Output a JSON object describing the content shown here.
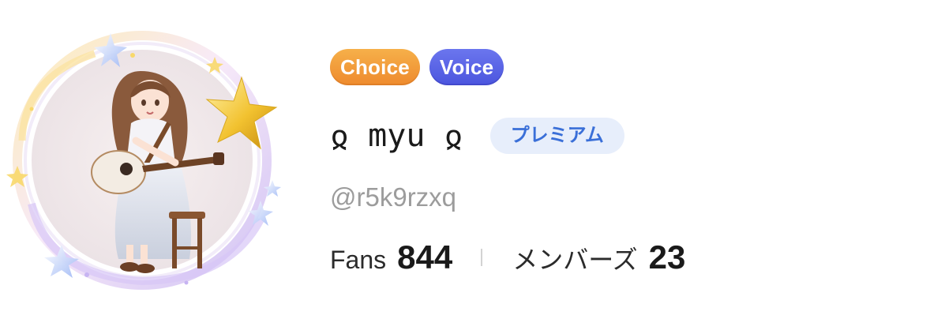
{
  "profile": {
    "badges": [
      {
        "label": "Choice",
        "color": "#ee8a2d"
      },
      {
        "label": "Voice",
        "color": "#4b55de"
      }
    ],
    "display_name": "ჲ myu ჲ",
    "premium_label": "プレミアム",
    "handle": "@r5k9rzxq",
    "stats": {
      "fans_label": "Fans",
      "fans_value": "844",
      "members_label": "メンバーズ",
      "members_value": "23"
    }
  },
  "colors": {
    "premium_bg": "#e7eefb",
    "premium_text": "#3a6fd8",
    "handle_text": "#9c9c9c"
  },
  "avatar": {
    "subject": "girl-playing-guitar-illustration",
    "frame": "starry-halo-frame"
  }
}
